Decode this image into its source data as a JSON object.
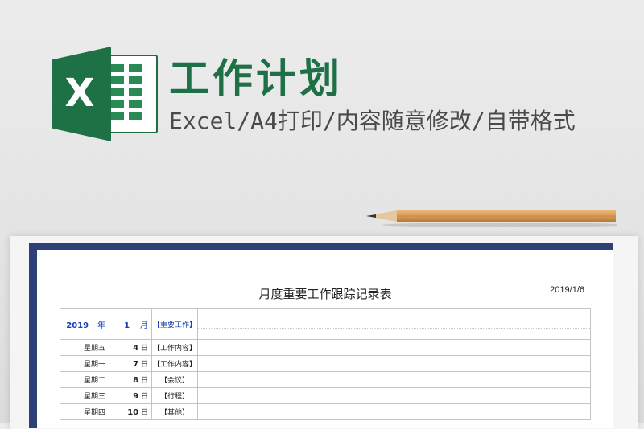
{
  "header": {
    "title": "工作计划",
    "subtitle": "Excel/A4打印/内容随意修改/自带格式",
    "logo_letter": "X"
  },
  "colors": {
    "excel_green": "#1d7145",
    "card_navy": "#2f3f77",
    "card_teal": "#5db6c5",
    "link_blue": "#1a3fb4"
  },
  "sheet": {
    "title": "月度重要工作跟踪记录表",
    "date": "2019/1/6",
    "head": {
      "year": "2019",
      "year_unit": "年",
      "month": "1",
      "month_unit": "月",
      "label": "【重要工作】"
    },
    "rows": [
      {
        "weekday": "星期五",
        "day": "4",
        "unit": "日",
        "category": "【工作内容】"
      },
      {
        "weekday": "星期一",
        "day": "7",
        "unit": "日",
        "category": "【工作内容】"
      },
      {
        "weekday": "星期二",
        "day": "8",
        "unit": "日",
        "category": "【会议】"
      },
      {
        "weekday": "星期三",
        "day": "9",
        "unit": "日",
        "category": "【行程】"
      },
      {
        "weekday": "星期四",
        "day": "10",
        "unit": "日",
        "category": "【其他】"
      }
    ]
  }
}
